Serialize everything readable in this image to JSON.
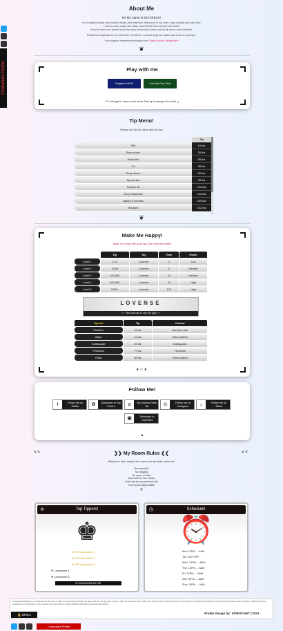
{
  "sidebar": {
    "vertical_label": "Chaturbate Profile",
    "accent": "#ff3b3b"
  },
  "about": {
    "title": "About Me",
    "name_line": "Hi! My name is MISTRESS!",
    "line1": "I'm a playful model who loves to tease and entertain. Welcome to my room, stay a while and have fun!",
    "line2": "I love to chat, laugh and make new friends from all over the world.",
    "line3": "If you're new here please read my rules below and check out my tip menu and schedule.",
    "line4": "Please be respectful to me and other members. Lovense toys are active and react to your tips.",
    "line5": "Your support means everything to me",
    "line5_hl": "Thank you for being here!",
    "ornament": "❦"
  },
  "play": {
    "title": "Play with me",
    "btn1": "Register NOW",
    "btn2": "Join My Fan Club",
    "note": "Let's get to know each other, first tip is always the best!"
  },
  "tip_menu": {
    "title": "Tip Menu!",
    "subtitle": "Please use the tip menu and be nice",
    "header": "Tip",
    "items": [
      {
        "label": "PM",
        "price": "10 tks"
      },
      {
        "label": "Blow a kiss",
        "price": "20 tks"
      },
      {
        "label": "Show tits",
        "price": "50 tks"
      },
      {
        "label": "Oil",
        "price": "55 tks"
      },
      {
        "label": "Sexy dance",
        "price": "60 tks"
      },
      {
        "label": "Spank ass",
        "price": "99 tks"
      },
      {
        "label": "Panties off",
        "price": "100 tks"
      },
      {
        "label": "Sexy Striptease",
        "price": "150 tks"
      },
      {
        "label": "Naked 5 minutes",
        "price": "200 tks"
      },
      {
        "label": "Random",
        "price": "222 tks"
      }
    ]
  },
  "happy": {
    "title": "Make Me Happy!",
    "subtitle": "Make me moan with your tips, the more the better!",
    "headers": [
      "Tip",
      "Toy",
      "Time",
      "Power"
    ],
    "levels": [
      {
        "lvl": "Level 1",
        "tip": "1-14",
        "toy": "Lovense",
        "time": "3",
        "power": "Low"
      },
      {
        "lvl": "Level 2",
        "tip": "15-99",
        "toy": "Lovense",
        "time": "5",
        "power": "Medium"
      },
      {
        "lvl": "Level 3",
        "tip": "100-499",
        "toy": "Lovense",
        "time": "10",
        "power": "Medium"
      },
      {
        "lvl": "Level 4",
        "tip": "500-999",
        "toy": "Lovense",
        "time": "30",
        "power": "High"
      },
      {
        "lvl": "Level 5",
        "tip": "1000+",
        "toy": "Lovense",
        "time": "120",
        "power": "High"
      }
    ],
    "lovense_logo": "LOVENSE",
    "lovense_bar": "Find out how to use the toys",
    "special_headers": [
      "Special",
      "Tip",
      "Control"
    ],
    "specials": [
      {
        "name": "Random",
        "tip": "33 tks",
        "control": "Random vibe"
      },
      {
        "name": "Wave",
        "tip": "44 tks",
        "control": "Wave pattern"
      },
      {
        "name": "Earthquake",
        "tip": "55 tks",
        "control": "Earthquake"
      },
      {
        "name": "Fireworks",
        "tip": "77 tks",
        "control": "Fireworks"
      },
      {
        "name": "Pulse",
        "tip": "88 tks",
        "control": "Pulse pattern"
      }
    ],
    "divider": "★ ✩ ★"
  },
  "follow": {
    "title": "Follow Me!",
    "buttons": [
      {
        "icon": "t",
        "text": "Follow me on Twitter"
      },
      {
        "icon": "✿",
        "text": "Subscribe to Fan Centro"
      },
      {
        "icon": "a",
        "text": "My Amazon Wish list"
      },
      {
        "icon": "◎",
        "text": "Follow me on Instagram"
      },
      {
        "icon": "♪",
        "text": "Follow me on Tiktok"
      },
      {
        "icon": "▣",
        "text": "Subscribe to OnlyFans"
      }
    ]
  },
  "rules": {
    "title": "❯❯ My Room Rules ❮❮",
    "intro": "Please be nice, respect the room and my limits, have fun!",
    "lines": [
      "Be respectful",
      "No begging",
      "No spam or links",
      "Don't ask for free shows",
      "Don't ask for my personal info",
      "Tip to show appreciation"
    ],
    "divider": "©"
  },
  "tippers": {
    "title": "Top Tippers!",
    "ranks": [
      "1st ⚙ Username 1",
      "2nd ⚙ Username 2",
      "3rd ⚙ Username 3",
      "⚙ Username 4",
      "⚙ Username 5"
    ],
    "bar": "MY DONATIONS SO FAR"
  },
  "schedule": {
    "title": "Schedule!",
    "days": [
      "Mon 12PM → 6AM",
      "Tue: DAY OFF",
      "Wed: 12PM → 6AM",
      "Thu: 12PM → 6AM",
      "Fri: 12PM → 6AM",
      "Sat: 12PM → 6AM",
      "Sun: 12PM → 6AM"
    ]
  },
  "footer": {
    "text": "All models appearing on this website are 18 years or older. By entering this website you agree that you are 18 years of age or older. All content on this profile is the property of the model and may not be copied or used without permission. Profile layout and graphics are protected. Unauthorized use, reproduction or distribution of any material from this profile is strictly prohibited and will be reported under DMCA.",
    "dmca": "DMCA",
    "design": "Profile Design by: VIDEOCHAT CASA",
    "bottom_label": "Chaturbate Profile"
  }
}
